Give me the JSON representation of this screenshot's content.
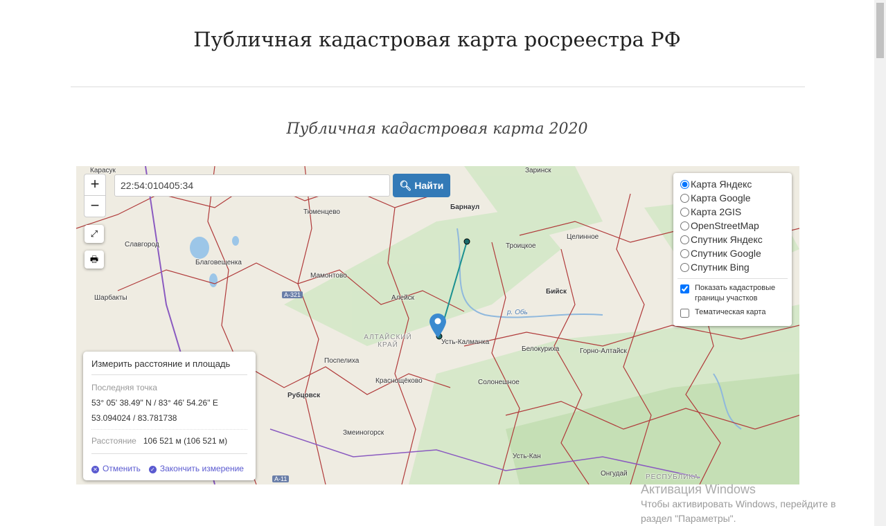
{
  "page": {
    "title": "Публичная кадастровая карта росреестра РФ",
    "subtitle": "Публичная кадастровая карта 2020"
  },
  "map": {
    "zoom_in": "+",
    "zoom_out": "−",
    "search": {
      "value": "22:54:010405:34"
    },
    "find_label": "Найти",
    "labels": [
      "Карасук",
      "Тюменцево",
      "Барнаул",
      "Заринск",
      "Славгород",
      "Благовещенка",
      "Мамонтово",
      "Троицкое",
      "Целинное",
      "Шарбакты",
      "Алейск",
      "Бийск",
      "р. Обь",
      "АЛТАЙСКИЙ КРАЙ",
      "Усть-Калманка",
      "Белокуриха",
      "Горно-Алтайск",
      "Поспелиха",
      "Краснощёково",
      "Солонешное",
      "Рубцовск",
      "Змеиногорск",
      "Усть-Кан",
      "Онгудай",
      "РЕСПУБЛИКА"
    ],
    "roads": [
      "A-321",
      "A-11"
    ],
    "layers": {
      "options": [
        "Карта Яндекс",
        "Карта Google",
        "Карта 2GIS",
        "OpenStreetMap",
        "Спутник Яндекс",
        "Спутник Google",
        "Спутник Bing"
      ],
      "selected": 0,
      "show_cadastral": "Показать кадастровые границы участков",
      "show_cadastral_checked": true,
      "thematic": "Тематическая карта",
      "thematic_checked": false
    },
    "measure": {
      "title": "Измерить расстояние и площадь",
      "last_point_label": "Последняя точка",
      "dms": "53° 05' 38.49\" N / 83° 46' 54.26\" E",
      "decimal": "53.094024 / 83.781738",
      "distance_label": "Расстояние",
      "distance_value": "106 521 м (106 521 м)",
      "cancel": "Отменить",
      "finish": "Закончить измерение"
    }
  },
  "watermark": {
    "title": "Активация Windows",
    "text": "Чтобы активировать Windows, перейдите в раздел \"Параметры\"."
  },
  "colors": {
    "accent": "#337ab7",
    "boundary": "#b03a3a",
    "link": "#5a5ad0"
  }
}
